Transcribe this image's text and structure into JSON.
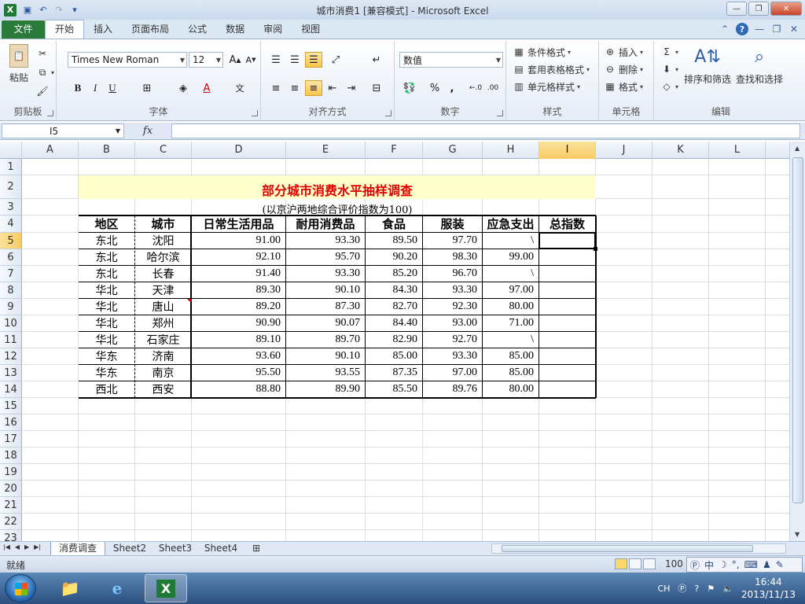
{
  "window": {
    "title": "城市消费1  [兼容模式] - Microsoft Excel",
    "app_icon_letter": "X"
  },
  "ribbon_tabs": [
    {
      "label": "文件"
    },
    {
      "label": "开始"
    },
    {
      "label": "插入"
    },
    {
      "label": "页面布局"
    },
    {
      "label": "公式"
    },
    {
      "label": "数据"
    },
    {
      "label": "审阅"
    },
    {
      "label": "视图"
    }
  ],
  "ribbon": {
    "clipboard": {
      "label": "剪贴板",
      "paste": "粘贴"
    },
    "font": {
      "label": "字体",
      "font_name": "Times New Roman",
      "font_size": "12"
    },
    "alignment": {
      "label": "对齐方式"
    },
    "number": {
      "label": "数字",
      "format": "数值"
    },
    "styles": {
      "label": "样式",
      "conditional": "条件格式",
      "table_format": "套用表格格式",
      "cell_styles": "单元格样式"
    },
    "cells": {
      "label": "单元格",
      "insert": "插入",
      "delete": "删除",
      "format": "格式"
    },
    "editing": {
      "label": "编辑",
      "sort_filter": "排序和筛选",
      "find_select": "查找和选择"
    }
  },
  "formula_bar": {
    "name_box": "I5",
    "fx": "fx",
    "formula": ""
  },
  "columns": [
    "A",
    "B",
    "C",
    "D",
    "E",
    "F",
    "G",
    "H",
    "I",
    "J",
    "K",
    "L"
  ],
  "rows": [
    "1",
    "2",
    "3",
    "4",
    "5",
    "6",
    "7",
    "8",
    "9",
    "10",
    "11",
    "12",
    "13",
    "14",
    "15",
    "16",
    "17",
    "18",
    "19",
    "20",
    "21",
    "22",
    "23"
  ],
  "sheet": {
    "title": "部分城市消费水平抽样调查",
    "subtitle": "(以京沪两地综合评价指数为100)",
    "headers": [
      "地区",
      "城市",
      "日常生活用品",
      "耐用消费品",
      "食品",
      "服装",
      "应急支出",
      "总指数"
    ],
    "data": [
      [
        "东北",
        "沈阳",
        "91.00",
        "93.30",
        "89.50",
        "97.70",
        "\\",
        ""
      ],
      [
        "东北",
        "哈尔滨",
        "92.10",
        "95.70",
        "90.20",
        "98.30",
        "99.00",
        ""
      ],
      [
        "东北",
        "长春",
        "91.40",
        "93.30",
        "85.20",
        "96.70",
        "\\",
        ""
      ],
      [
        "华北",
        "天津",
        "89.30",
        "90.10",
        "84.30",
        "93.30",
        "97.00",
        ""
      ],
      [
        "华北",
        "唐山",
        "89.20",
        "87.30",
        "82.70",
        "92.30",
        "80.00",
        ""
      ],
      [
        "华北",
        "郑州",
        "90.90",
        "90.07",
        "84.40",
        "93.00",
        "71.00",
        ""
      ],
      [
        "华北",
        "石家庄",
        "89.10",
        "89.70",
        "82.90",
        "92.70",
        "\\",
        ""
      ],
      [
        "华东",
        "济南",
        "93.60",
        "90.10",
        "85.00",
        "93.30",
        "85.00",
        ""
      ],
      [
        "华东",
        "南京",
        "95.50",
        "93.55",
        "87.35",
        "97.00",
        "85.00",
        ""
      ],
      [
        "西北",
        "西安",
        "88.80",
        "89.90",
        "85.50",
        "89.76",
        "80.00",
        ""
      ]
    ]
  },
  "sheet_tabs": [
    {
      "label": "消费调查"
    },
    {
      "label": "Sheet2"
    },
    {
      "label": "Sheet3"
    },
    {
      "label": "Sheet4"
    }
  ],
  "status": {
    "ready": "就绪",
    "zoom": "100"
  },
  "ime": {
    "lang": "CH"
  },
  "taskbar": {
    "time": "16:44",
    "date": "2013/11/13",
    "lang": "CH"
  }
}
